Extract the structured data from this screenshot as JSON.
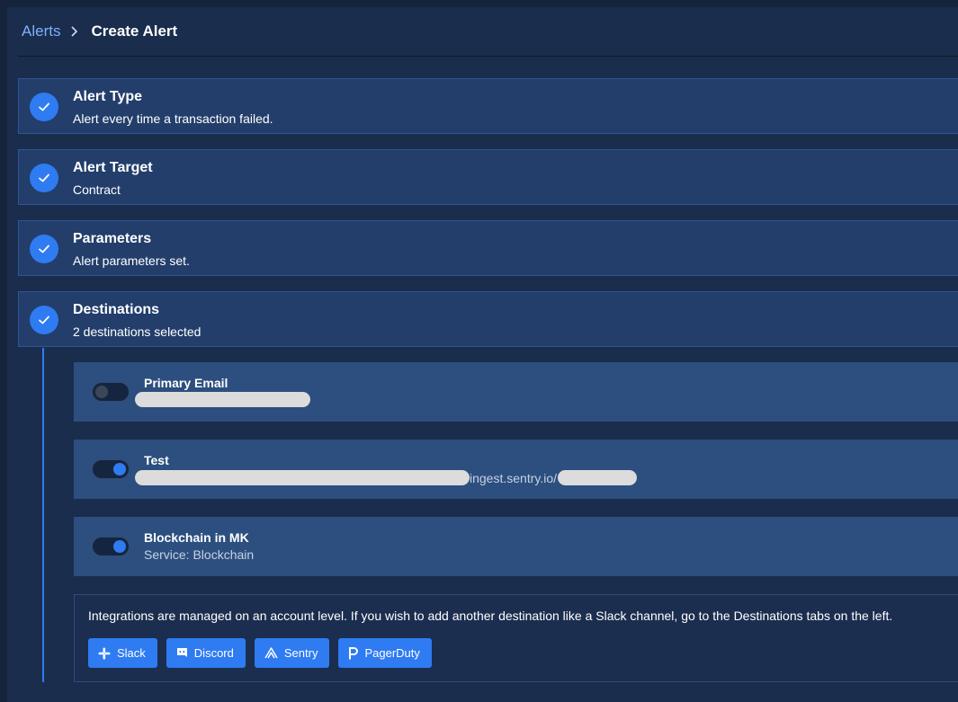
{
  "breadcrumb": {
    "parent": "Alerts",
    "current": "Create Alert"
  },
  "steps": [
    {
      "title": "Alert Type",
      "subtitle": "Alert every time a transaction failed."
    },
    {
      "title": "Alert Target",
      "subtitle": "Contract"
    },
    {
      "title": "Parameters",
      "subtitle": "Alert parameters set."
    },
    {
      "title": "Destinations",
      "subtitle": "2 destinations selected"
    }
  ],
  "destinations": [
    {
      "name": "Primary Email",
      "enabled": false,
      "detail": ""
    },
    {
      "name": "Test",
      "enabled": true,
      "detail_visible": "ingest.sentry.io/"
    },
    {
      "name": "Blockchain in MK",
      "enabled": true,
      "detail": "Service: Blockchain"
    }
  ],
  "info": {
    "text": "Integrations are managed on an account level. If you wish to add another destination like a Slack channel, go to the Destinations tabs on the left."
  },
  "integrations": [
    {
      "label": "Slack",
      "icon": "slack-icon"
    },
    {
      "label": "Discord",
      "icon": "discord-icon"
    },
    {
      "label": "Sentry",
      "icon": "sentry-icon"
    },
    {
      "label": "PagerDuty",
      "icon": "pagerduty-icon"
    }
  ],
  "colors": {
    "accent": "#2f7bf2",
    "background": "#15233d",
    "card": "#233e6b",
    "link": "#7fb0ff"
  }
}
